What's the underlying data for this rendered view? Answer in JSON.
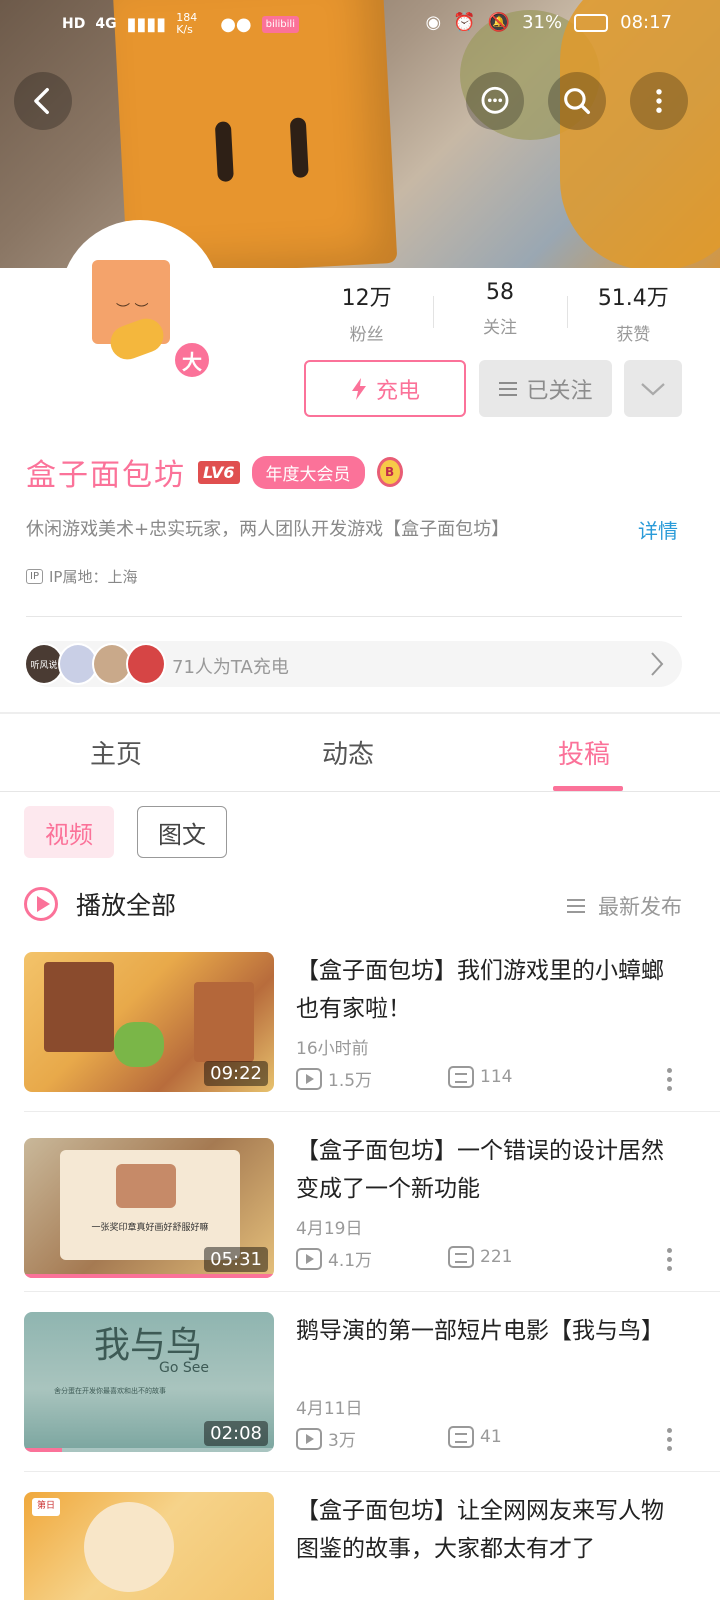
{
  "status_bar": {
    "network_hd": "HD",
    "network_gen": "4G",
    "speed": "184 K/s",
    "battery": "31%",
    "time": "08:17",
    "app_chip": "bilibili"
  },
  "top_nav": {
    "back": "back-icon",
    "message": "message-icon",
    "search": "search-icon",
    "more": "more-icon"
  },
  "profile": {
    "avatar_badge": "大",
    "stats": [
      {
        "value": "12万",
        "label": "粉丝"
      },
      {
        "value": "58",
        "label": "关注"
      },
      {
        "value": "51.4万",
        "label": "获赞"
      }
    ],
    "charge_label": "充电",
    "followed_label": "已关注",
    "name": "盒子面包坊",
    "level": "LV6",
    "vip_label": "年度大会员",
    "medal_text": "B",
    "bio": "休闲游戏美术+忠实玩家，两人团队开发游戏【盒子面包坊】",
    "detail_label": "详情",
    "ip_tag": "IP",
    "ip_location": "IP属地：上海",
    "supporters_text": "71人为TA充电",
    "supporter_avatar_text": "听风说"
  },
  "tabs": [
    {
      "label": "主页"
    },
    {
      "label": "动态"
    },
    {
      "label": "投稿"
    }
  ],
  "filters": {
    "video": "视频",
    "article": "图文"
  },
  "play_all": "播放全部",
  "sort_label": "最新发布",
  "videos": [
    {
      "title": "【盒子面包坊】我们游戏里的小蟑螂也有家啦！",
      "time": "16小时前",
      "views": "1.5万",
      "comments": "114",
      "duration": "09:22",
      "progress": 0.0
    },
    {
      "title": "【盒子面包坊】一个错误的设计居然变成了一个新功能",
      "time": "4月19日",
      "views": "4.1万",
      "comments": "221",
      "duration": "05:31",
      "progress": 1.0,
      "thumb_caption": "一张奖印章真好画好舒服好嘛"
    },
    {
      "title": "鹅导演的第一部短片电影【我与鸟】",
      "time": "4月11日",
      "views": "3万",
      "comments": "41",
      "duration": "02:08",
      "progress": 0.15,
      "thumb_caption_cn": "我与鸟",
      "thumb_caption_en": "Go See",
      "thumb_sub": "舍分蛋在开发你最喜欢和出不的故事"
    },
    {
      "title": "【盒子面包坊】让全网网友来写人物图鉴的故事，大家都太有才了",
      "thumb_badge": "第日"
    }
  ],
  "colors": {
    "accent": "#fb7299",
    "link": "#2a9bd8",
    "muted": "#999999"
  }
}
